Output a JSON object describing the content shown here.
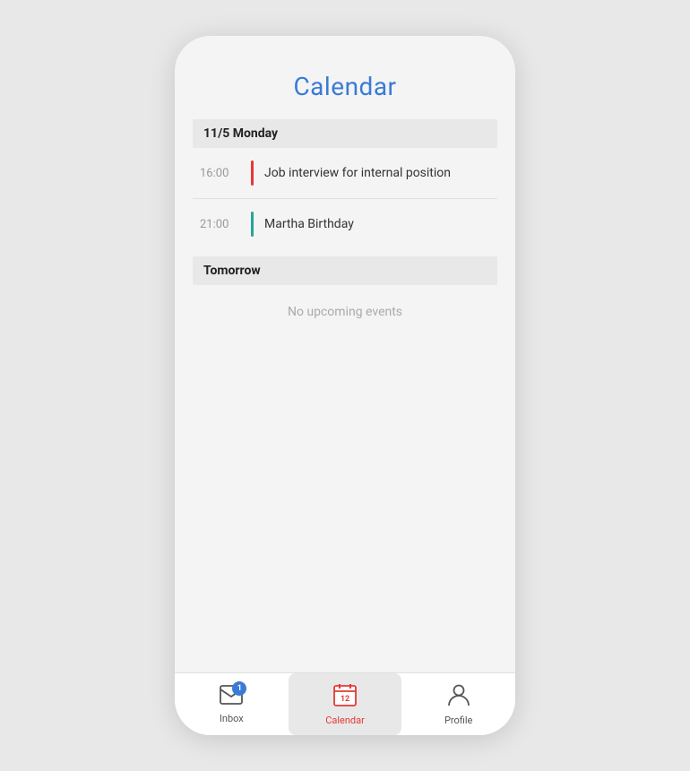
{
  "page": {
    "title": "Calendar",
    "background_color": "#e8e8e8"
  },
  "calendar": {
    "days": [
      {
        "label": "11/5 Monday",
        "events": [
          {
            "time": "16:00",
            "title": "Job interview for internal position",
            "bar_color": "red"
          },
          {
            "time": "21:00",
            "title": "Martha Birthday",
            "bar_color": "teal"
          }
        ]
      },
      {
        "label": "Tomorrow",
        "events": [],
        "no_events_text": "No upcoming events"
      }
    ]
  },
  "bottom_nav": {
    "items": [
      {
        "id": "inbox",
        "label": "Inbox",
        "badge": "1",
        "active": false
      },
      {
        "id": "calendar",
        "label": "Calendar",
        "badge": null,
        "active": true
      },
      {
        "id": "profile",
        "label": "Profile",
        "badge": null,
        "active": false
      }
    ]
  }
}
